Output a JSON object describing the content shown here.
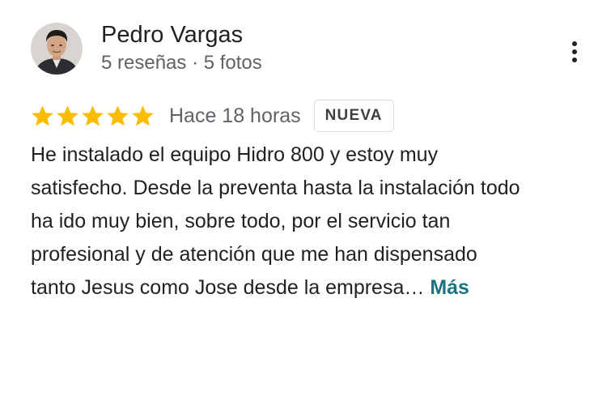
{
  "reviewer": {
    "name": "Pedro Vargas",
    "meta": "5 reseñas · 5 fotos",
    "avatar_icon": "person-avatar"
  },
  "menu": {
    "icon": "more-vertical-icon"
  },
  "review": {
    "rating": 5,
    "rating_max": 5,
    "star_color": "#fbbc04",
    "time": "Hace 18 horas",
    "badge": "NUEVA",
    "text_lines": [
      "He instalado el equipo Hidro 800 y estoy muy",
      "satisfecho. Desde la preventa hasta la instalación todo",
      "ha ido muy bien, sobre todo, por el servicio tan",
      "profesional y de atención que me han dispensado",
      "tanto Jesus como Jose desde la empresa…"
    ],
    "more_label": "Más",
    "more_color": "#1a737e"
  }
}
